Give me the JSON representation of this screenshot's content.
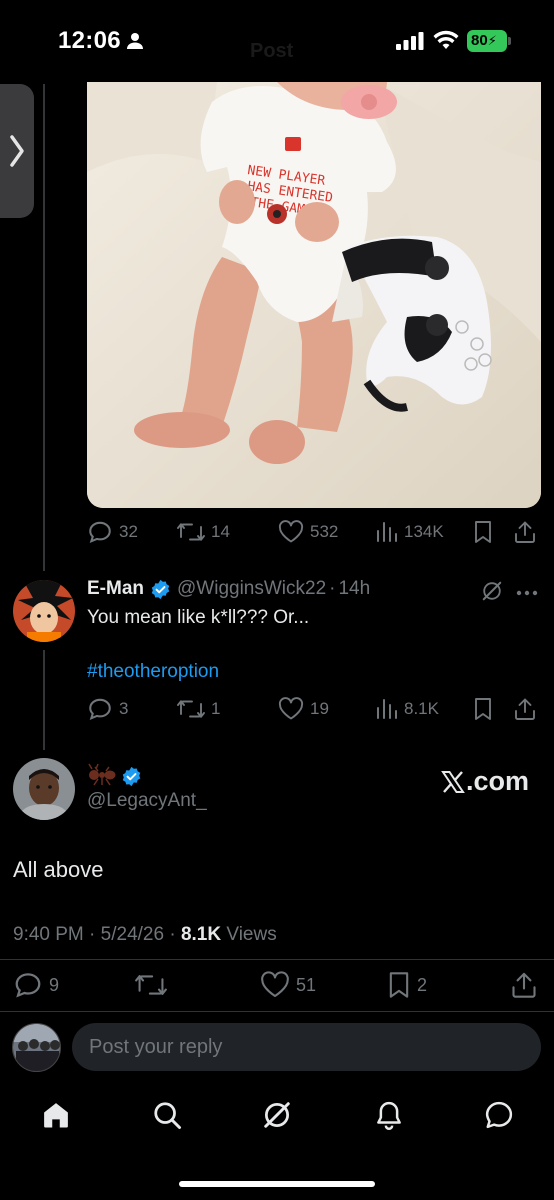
{
  "status_bar": {
    "time": "12:06",
    "battery": "80",
    "faded_title": "Post"
  },
  "media_post": {
    "image_alt": "Baby in onesie next to game controller",
    "onesie_text": [
      "NEW PLAYER",
      "HAS ENTERED",
      "THE GAME"
    ],
    "actions": {
      "replies": "32",
      "reposts": "14",
      "likes": "532",
      "views": "134K"
    }
  },
  "reply": {
    "name": "E-Man",
    "handle": "@WigginsWick22",
    "separator": "·",
    "time": "14h",
    "text": "You mean like k*ll??? Or...",
    "hashtag": "#theotheroption",
    "actions": {
      "replies": "3",
      "reposts": "1",
      "likes": "19",
      "views": "8.1K"
    }
  },
  "main_post": {
    "handle": "@LegacyAnt_",
    "watermark": ".com",
    "text": "All above",
    "time": "9:40 PM",
    "date": "5/24/26",
    "views_count": "8.1K",
    "views_label": "Views",
    "actions": {
      "replies": "9",
      "likes": "51",
      "bookmarks": "2"
    }
  },
  "reply_bar": {
    "placeholder": "Post your reply"
  },
  "colors": {
    "background": "#000000",
    "accent": "#1d9bf0",
    "muted": "#71767b",
    "text": "#e7e9ea",
    "battery": "#34c759"
  },
  "icons": [
    "person-icon",
    "signal-icon",
    "wifi-icon",
    "chevron-right-icon",
    "reply-icon",
    "repost-icon",
    "like-icon",
    "views-icon",
    "bookmark-icon",
    "share-icon",
    "grok-icon",
    "more-icon",
    "verified-icon",
    "ant-emoji-icon",
    "x-logo-icon",
    "home-icon",
    "search-icon",
    "notifications-icon",
    "messages-icon"
  ]
}
